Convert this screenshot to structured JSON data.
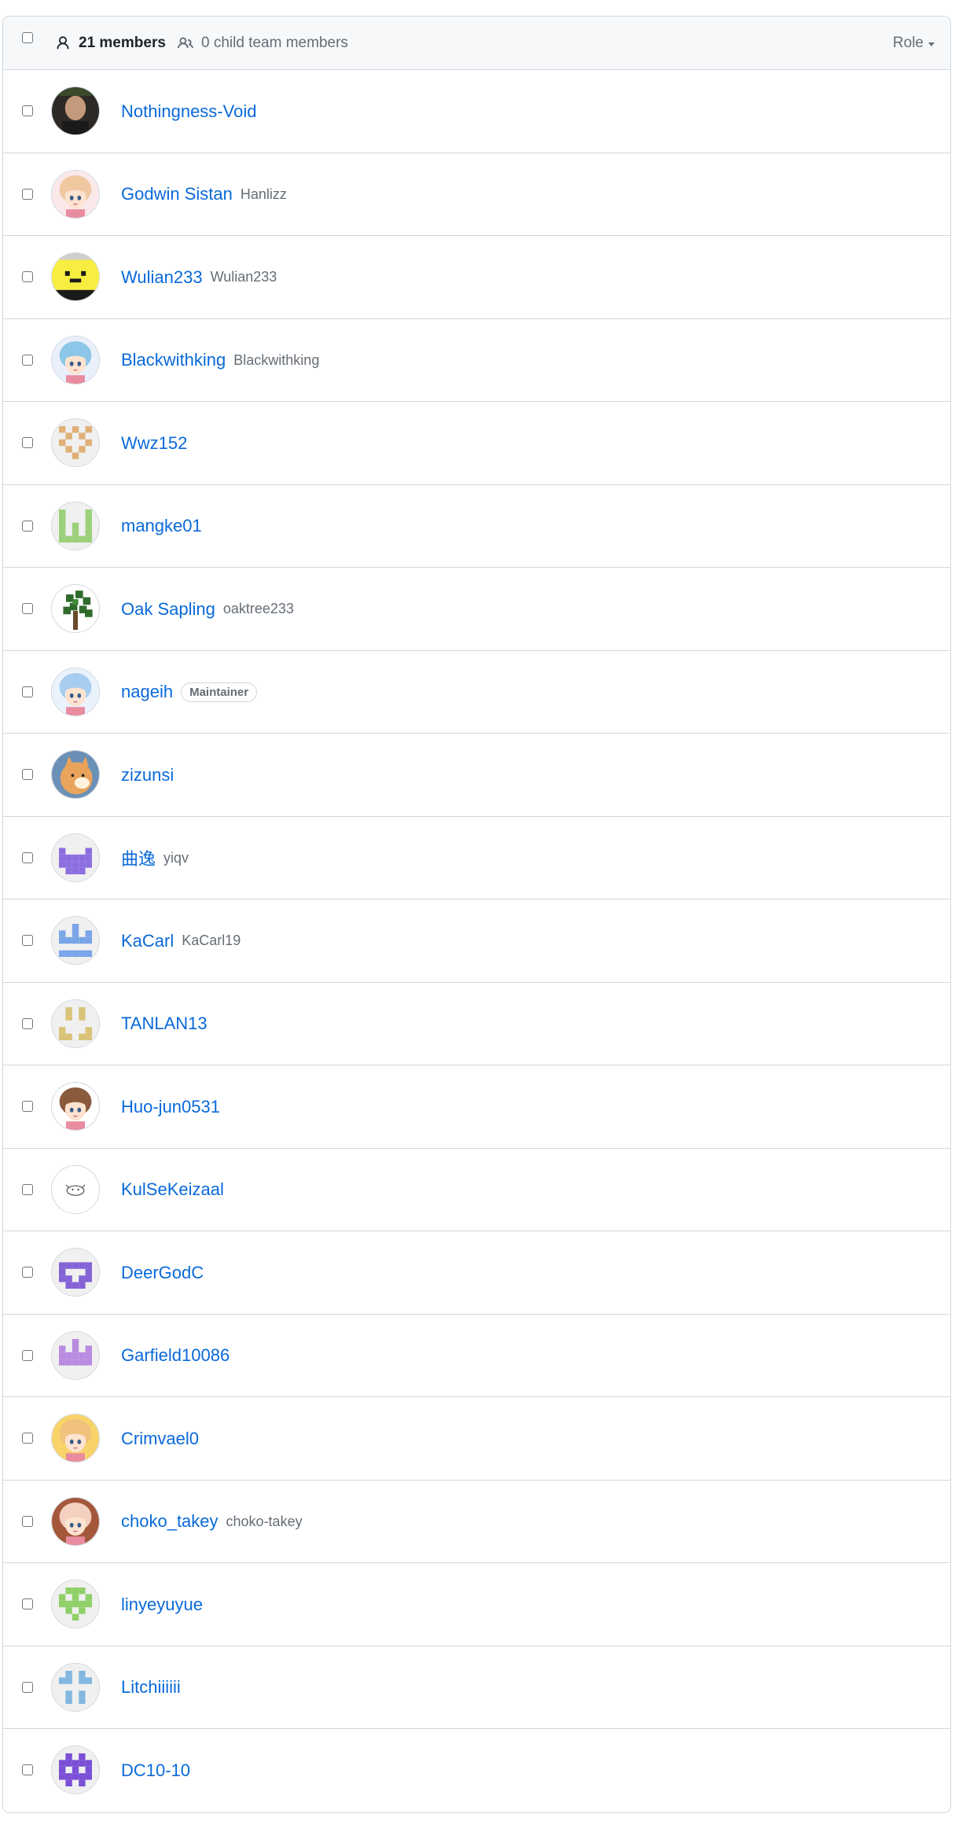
{
  "header": {
    "members_count": "21 members",
    "child_team_members": "0 child team members",
    "role_filter_label": "Role"
  },
  "members": [
    {
      "name": "Nothingness-Void",
      "login": "",
      "badge": "",
      "avatar": {
        "kind": "photo",
        "bg": "#2d2a26",
        "fg": "#c59a7c"
      }
    },
    {
      "name": "Godwin Sistan",
      "login": "Hanlizz",
      "badge": "",
      "avatar": {
        "kind": "anime",
        "bg": "#fbe9ea",
        "fg": "#f0c8a0"
      }
    },
    {
      "name": "Wulian233",
      "login": "Wulian233",
      "badge": "",
      "avatar": {
        "kind": "pixelface",
        "bg": "#f8ee41",
        "fg": "#1b1b1b"
      }
    },
    {
      "name": "Blackwithking",
      "login": "Blackwithking",
      "badge": "",
      "avatar": {
        "kind": "anime",
        "bg": "#e9f0fb",
        "fg": "#8cc6e8"
      }
    },
    {
      "name": "Wwz152",
      "login": "",
      "badge": "",
      "avatar": {
        "kind": "identicon",
        "bg": "#f0f0f0",
        "fg": "#e0b078",
        "pattern": "1.1.1/.1.1./1...1/.1.1./..1.."
      }
    },
    {
      "name": "mangke01",
      "login": "",
      "badge": "",
      "avatar": {
        "kind": "identicon",
        "bg": "#f0f0f0",
        "fg": "#9bd07a",
        "pattern": "1...1/1...1/1.1.1/1.1.1/11111"
      }
    },
    {
      "name": "Oak Sapling",
      "login": "oaktree233",
      "badge": "",
      "avatar": {
        "kind": "tree",
        "bg": "#ffffff",
        "fg": "#2f6b2a"
      }
    },
    {
      "name": "nageih",
      "login": "",
      "badge": "Maintainer",
      "avatar": {
        "kind": "anime",
        "bg": "#eaf2fb",
        "fg": "#a7cdf0"
      }
    },
    {
      "name": "zizunsi",
      "login": "",
      "badge": "",
      "avatar": {
        "kind": "dog",
        "bg": "#6b90b6",
        "fg": "#e9a35a"
      }
    },
    {
      "name": "曲逸",
      "login": "yiqv",
      "badge": "",
      "avatar": {
        "kind": "identicon",
        "bg": "#f0f0f0",
        "fg": "#8d6ee0",
        "pattern": "...../1...1/11111/11111/.111."
      }
    },
    {
      "name": "KaCarl",
      "login": "KaCarl19",
      "badge": "",
      "avatar": {
        "kind": "identicon",
        "bg": "#f0f0f0",
        "fg": "#7aa5e8",
        "pattern": "..1../1.1.1/11111/...../11111"
      }
    },
    {
      "name": "TANLAN13",
      "login": "",
      "badge": "",
      "avatar": {
        "kind": "identicon",
        "bg": "#f0f0f0",
        "fg": "#d9c378",
        "pattern": ".1.1./.1.1./...../1...1/11.11"
      }
    },
    {
      "name": "Huo-jun0531",
      "login": "",
      "badge": "",
      "avatar": {
        "kind": "anime",
        "bg": "#ffffff",
        "fg": "#8a5a3c"
      }
    },
    {
      "name": "KulSeKeizaal",
      "login": "",
      "badge": "",
      "avatar": {
        "kind": "sketch",
        "bg": "#ffffff",
        "fg": "#555555"
      }
    },
    {
      "name": "DeerGodC",
      "login": "",
      "badge": "",
      "avatar": {
        "kind": "identicon",
        "bg": "#f0f0f0",
        "fg": "#8463d6",
        "pattern": "...../11111/1...1/11.11/.111."
      }
    },
    {
      "name": "Garfield10086",
      "login": "",
      "badge": "",
      "avatar": {
        "kind": "identicon",
        "bg": "#f0f0f0",
        "fg": "#b98be0",
        "pattern": "..1../1.1.1/11111/11111/....."
      }
    },
    {
      "name": "Crimvael0",
      "login": "",
      "badge": "",
      "avatar": {
        "kind": "anime",
        "bg": "#f7d36a",
        "fg": "#f1c27d"
      }
    },
    {
      "name": "choko_takey",
      "login": "choko-takey",
      "badge": "",
      "avatar": {
        "kind": "anime",
        "bg": "#a5573c",
        "fg": "#f3d0c0"
      }
    },
    {
      "name": "linyeyuyue",
      "login": "",
      "badge": "",
      "avatar": {
        "kind": "identicon",
        "bg": "#f0f0f0",
        "fg": "#8fd068",
        "pattern": ".111./1.1.1/11111/.1.1./..1.."
      }
    },
    {
      "name": "Litchiiiiii",
      "login": "",
      "badge": "",
      "avatar": {
        "kind": "identicon",
        "bg": "#f0f0f0",
        "fg": "#82b8e0",
        "pattern": ".1.1./11.11/...../.1.1./.1.1."
      }
    },
    {
      "name": "DC10-10",
      "login": "",
      "badge": "",
      "avatar": {
        "kind": "identicon",
        "bg": "#f0f0f0",
        "fg": "#7b4fd6",
        "pattern": ".1.1./11111/1.1.1/11111/.1.1."
      }
    }
  ]
}
